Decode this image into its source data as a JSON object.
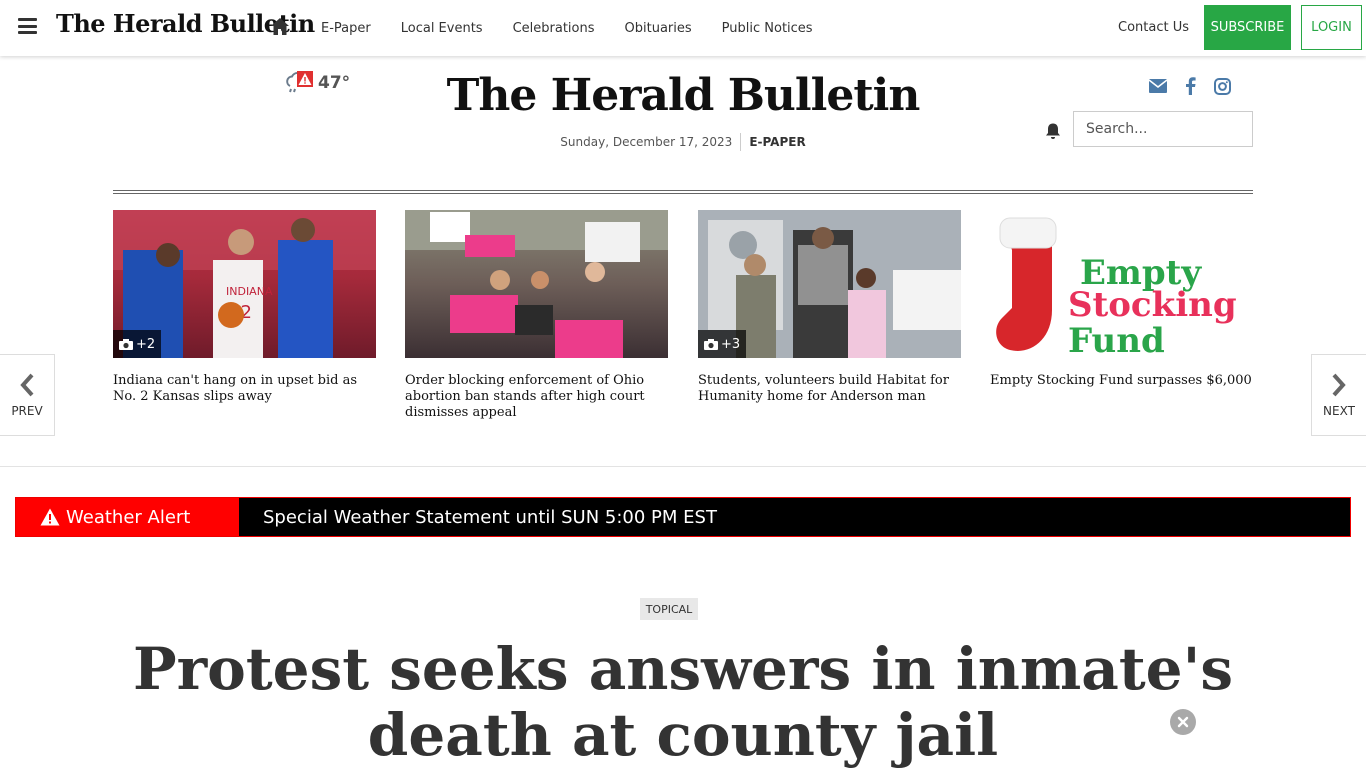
{
  "topnav": {
    "logo": "The Herald Bulletin",
    "links": [
      "E-Paper",
      "Local Events",
      "Celebrations",
      "Obituaries",
      "Public Notices"
    ],
    "contact": "Contact Us",
    "subscribe": "SUBSCRIBE",
    "login": "LOGIN"
  },
  "masthead": {
    "temperature": "47°",
    "logo": "The Herald Bulletin",
    "date": "Sunday, December 17, 2023",
    "epaper": "E-PAPER",
    "search_placeholder": "Search...",
    "social_icons": [
      "envelope-icon",
      "facebook-icon",
      "instagram-icon"
    ]
  },
  "carousel": {
    "prev_label": "PREV",
    "next_label": "NEXT",
    "items": [
      {
        "headline": "Indiana can't hang on in upset bid as No. 2 Kansas slips away",
        "photo_count": "+2"
      },
      {
        "headline": "Order blocking enforcement of Ohio abortion ban stands after high court dismisses appeal",
        "photo_count": ""
      },
      {
        "headline": "Students, volunteers build Habitat for Humanity home for Anderson man",
        "photo_count": "+3"
      },
      {
        "headline": "Empty Stocking Fund surpasses $6,000",
        "photo_count": ""
      }
    ],
    "empty_stocking_art": [
      "Empty",
      "Stocking",
      "Fund"
    ]
  },
  "weather_alert": {
    "label": "Weather Alert",
    "message": "Special Weather Statement until SUN 5:00 PM EST"
  },
  "article": {
    "topic": "TOPICAL",
    "title": "Protest seeks answers in inmate's death at county jail"
  },
  "colors": {
    "accent_green": "#28a745",
    "alert_red": "#ff0000",
    "alert_bg": "#000000"
  }
}
